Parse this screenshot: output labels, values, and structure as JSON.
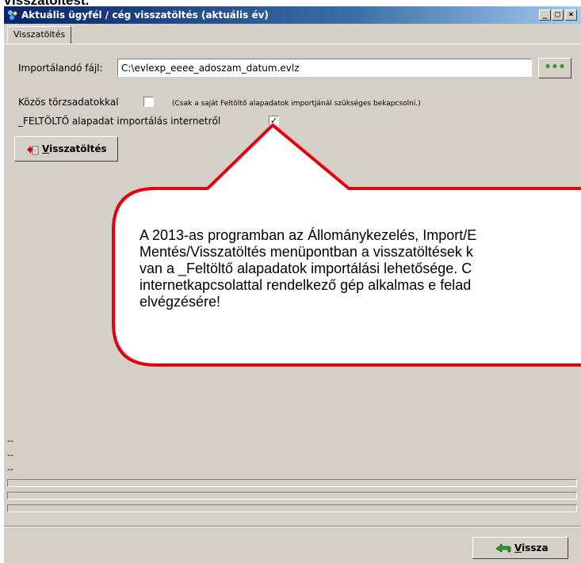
{
  "top_cut_text": "Visszatöltést.",
  "window": {
    "title": "Aktuális ügyfél / cég visszatöltés (aktuális év)",
    "buttons": [
      "_",
      "□",
      "×"
    ]
  },
  "tabs": [
    {
      "label": "Visszatöltés",
      "active": true
    }
  ],
  "form": {
    "import_file_label": "Importálandó fájl:",
    "import_file_value": "C:\\evlexp_eeee_adoszam_datum.evlz",
    "browse_button_label": "•••",
    "common_master_label": "Közös törzsadatokkal",
    "common_master_checked": false,
    "common_master_hint": "(Csak a saját Feltöltő alapadatok importjánál szükséges bekapcsolni.)",
    "feltolto_label": "_FELTÖLTŐ alapadat importálás internetről",
    "feltolto_checked": true,
    "restore_button": {
      "underlined": "V",
      "rest": "isszatöltés"
    }
  },
  "status_lines": [
    "--",
    "--",
    "--"
  ],
  "progress_bars": [
    0,
    0,
    0
  ],
  "footer": {
    "back_button": {
      "underlined": "V",
      "rest": "issza"
    }
  },
  "callout": {
    "text": "A 2013-as programban az Állománykezelés, Import/E\nMentés/Visszatöltés menüpontban a visszatöltések k\nvan a _Feltöltő alapadatok importálási lehetősége. C\ninternetkapcsolattal rendelkező gép alkalmas e felad\nelvégzésére!",
    "border_color": "#e8000c"
  },
  "colors": {
    "window_bg": "#d4d0c8",
    "titlebar_start": "#0a246a",
    "titlebar_end": "#a6caf0",
    "dots_color": "#2a9a2a"
  }
}
